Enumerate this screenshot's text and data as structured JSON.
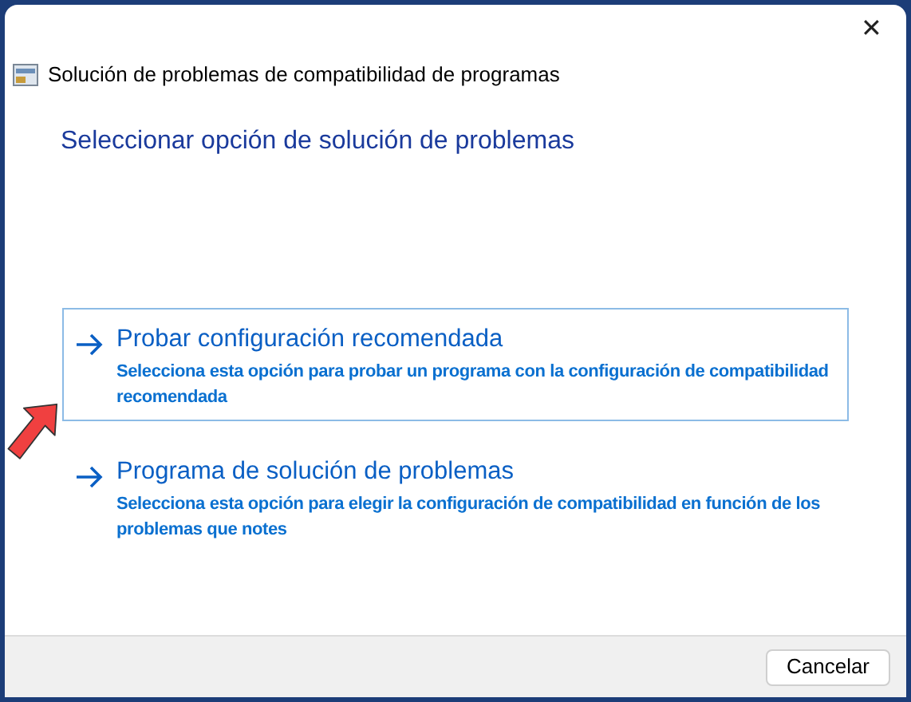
{
  "window": {
    "title": "Solución de problemas de compatibilidad de programas",
    "close": "✕"
  },
  "heading": "Seleccionar opción de solución de problemas",
  "options": [
    {
      "title": "Probar configuración recomendada",
      "description": "Selecciona esta opción para probar un programa con la configuración de compatibilidad recomendada",
      "selected": true
    },
    {
      "title": "Programa de solución de problemas",
      "description": "Selecciona esta opción para elegir la configuración de compatibilidad en función de los problemas que notes",
      "selected": false
    }
  ],
  "buttons": [
    "Cancelar"
  ]
}
